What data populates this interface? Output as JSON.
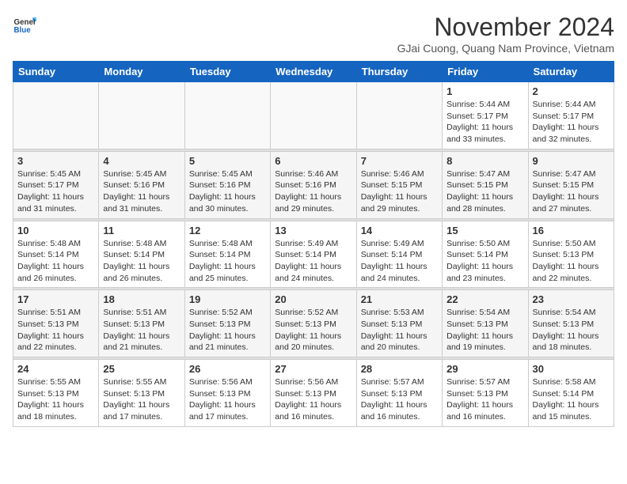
{
  "header": {
    "logo_line1": "General",
    "logo_line2": "Blue",
    "month_title": "November 2024",
    "location": "GJai Cuong, Quang Nam Province, Vietnam"
  },
  "weekdays": [
    "Sunday",
    "Monday",
    "Tuesday",
    "Wednesday",
    "Thursday",
    "Friday",
    "Saturday"
  ],
  "weeks": [
    [
      {
        "day": "",
        "info": ""
      },
      {
        "day": "",
        "info": ""
      },
      {
        "day": "",
        "info": ""
      },
      {
        "day": "",
        "info": ""
      },
      {
        "day": "",
        "info": ""
      },
      {
        "day": "1",
        "info": "Sunrise: 5:44 AM\nSunset: 5:17 PM\nDaylight: 11 hours\nand 33 minutes."
      },
      {
        "day": "2",
        "info": "Sunrise: 5:44 AM\nSunset: 5:17 PM\nDaylight: 11 hours\nand 32 minutes."
      }
    ],
    [
      {
        "day": "3",
        "info": "Sunrise: 5:45 AM\nSunset: 5:17 PM\nDaylight: 11 hours\nand 31 minutes."
      },
      {
        "day": "4",
        "info": "Sunrise: 5:45 AM\nSunset: 5:16 PM\nDaylight: 11 hours\nand 31 minutes."
      },
      {
        "day": "5",
        "info": "Sunrise: 5:45 AM\nSunset: 5:16 PM\nDaylight: 11 hours\nand 30 minutes."
      },
      {
        "day": "6",
        "info": "Sunrise: 5:46 AM\nSunset: 5:16 PM\nDaylight: 11 hours\nand 29 minutes."
      },
      {
        "day": "7",
        "info": "Sunrise: 5:46 AM\nSunset: 5:15 PM\nDaylight: 11 hours\nand 29 minutes."
      },
      {
        "day": "8",
        "info": "Sunrise: 5:47 AM\nSunset: 5:15 PM\nDaylight: 11 hours\nand 28 minutes."
      },
      {
        "day": "9",
        "info": "Sunrise: 5:47 AM\nSunset: 5:15 PM\nDaylight: 11 hours\nand 27 minutes."
      }
    ],
    [
      {
        "day": "10",
        "info": "Sunrise: 5:48 AM\nSunset: 5:14 PM\nDaylight: 11 hours\nand 26 minutes."
      },
      {
        "day": "11",
        "info": "Sunrise: 5:48 AM\nSunset: 5:14 PM\nDaylight: 11 hours\nand 26 minutes."
      },
      {
        "day": "12",
        "info": "Sunrise: 5:48 AM\nSunset: 5:14 PM\nDaylight: 11 hours\nand 25 minutes."
      },
      {
        "day": "13",
        "info": "Sunrise: 5:49 AM\nSunset: 5:14 PM\nDaylight: 11 hours\nand 24 minutes."
      },
      {
        "day": "14",
        "info": "Sunrise: 5:49 AM\nSunset: 5:14 PM\nDaylight: 11 hours\nand 24 minutes."
      },
      {
        "day": "15",
        "info": "Sunrise: 5:50 AM\nSunset: 5:14 PM\nDaylight: 11 hours\nand 23 minutes."
      },
      {
        "day": "16",
        "info": "Sunrise: 5:50 AM\nSunset: 5:13 PM\nDaylight: 11 hours\nand 22 minutes."
      }
    ],
    [
      {
        "day": "17",
        "info": "Sunrise: 5:51 AM\nSunset: 5:13 PM\nDaylight: 11 hours\nand 22 minutes."
      },
      {
        "day": "18",
        "info": "Sunrise: 5:51 AM\nSunset: 5:13 PM\nDaylight: 11 hours\nand 21 minutes."
      },
      {
        "day": "19",
        "info": "Sunrise: 5:52 AM\nSunset: 5:13 PM\nDaylight: 11 hours\nand 21 minutes."
      },
      {
        "day": "20",
        "info": "Sunrise: 5:52 AM\nSunset: 5:13 PM\nDaylight: 11 hours\nand 20 minutes."
      },
      {
        "day": "21",
        "info": "Sunrise: 5:53 AM\nSunset: 5:13 PM\nDaylight: 11 hours\nand 20 minutes."
      },
      {
        "day": "22",
        "info": "Sunrise: 5:54 AM\nSunset: 5:13 PM\nDaylight: 11 hours\nand 19 minutes."
      },
      {
        "day": "23",
        "info": "Sunrise: 5:54 AM\nSunset: 5:13 PM\nDaylight: 11 hours\nand 18 minutes."
      }
    ],
    [
      {
        "day": "24",
        "info": "Sunrise: 5:55 AM\nSunset: 5:13 PM\nDaylight: 11 hours\nand 18 minutes."
      },
      {
        "day": "25",
        "info": "Sunrise: 5:55 AM\nSunset: 5:13 PM\nDaylight: 11 hours\nand 17 minutes."
      },
      {
        "day": "26",
        "info": "Sunrise: 5:56 AM\nSunset: 5:13 PM\nDaylight: 11 hours\nand 17 minutes."
      },
      {
        "day": "27",
        "info": "Sunrise: 5:56 AM\nSunset: 5:13 PM\nDaylight: 11 hours\nand 16 minutes."
      },
      {
        "day": "28",
        "info": "Sunrise: 5:57 AM\nSunset: 5:13 PM\nDaylight: 11 hours\nand 16 minutes."
      },
      {
        "day": "29",
        "info": "Sunrise: 5:57 AM\nSunset: 5:13 PM\nDaylight: 11 hours\nand 16 minutes."
      },
      {
        "day": "30",
        "info": "Sunrise: 5:58 AM\nSunset: 5:14 PM\nDaylight: 11 hours\nand 15 minutes."
      }
    ]
  ]
}
